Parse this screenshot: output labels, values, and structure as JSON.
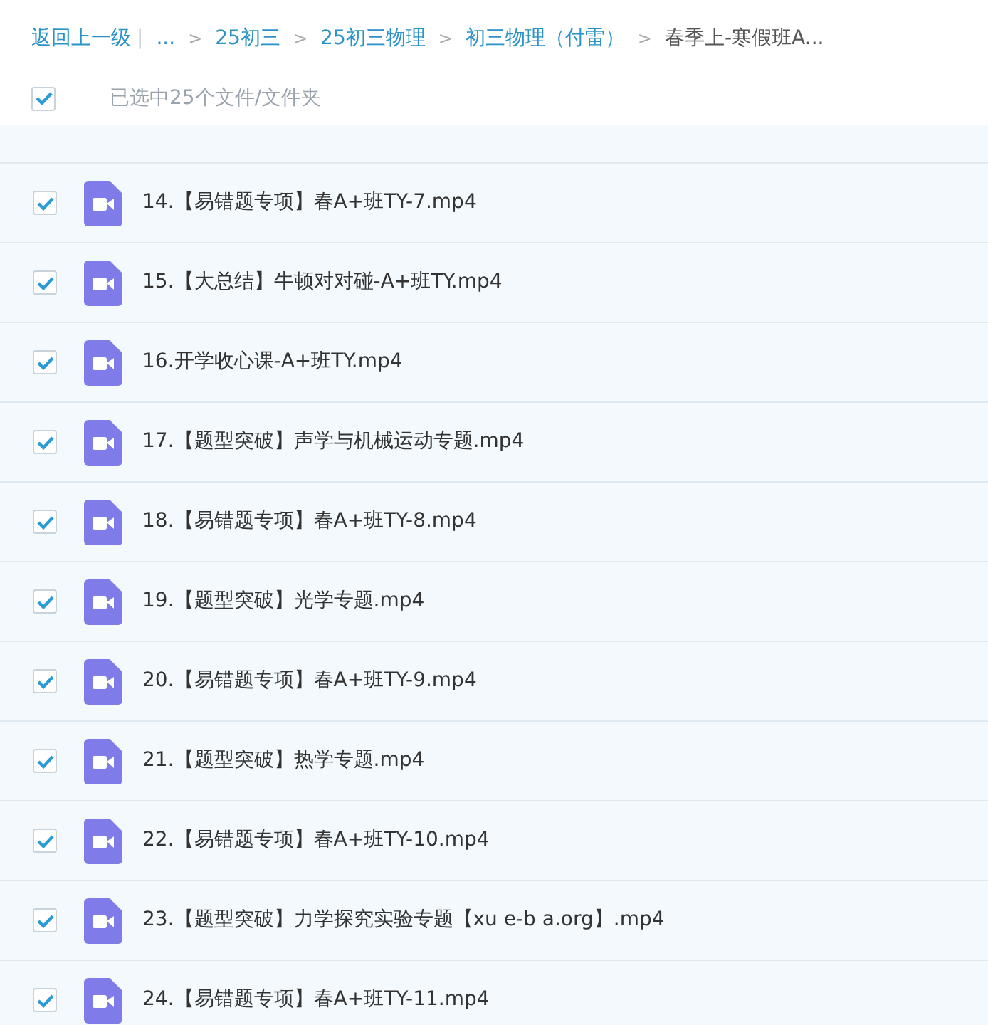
{
  "breadcrumb": {
    "back": "返回上一级",
    "divider": "|",
    "items": [
      {
        "label": "...",
        "current": false
      },
      {
        "label": "25初三",
        "current": false
      },
      {
        "label": "25初三物理",
        "current": false
      },
      {
        "label": "初三物理（付雷）",
        "current": false
      },
      {
        "label": "春季上-寒假班A...",
        "current": true
      }
    ],
    "separator": ">"
  },
  "selection": {
    "checked": true,
    "label": "已选中25个文件/文件夹"
  },
  "files": [
    {
      "name": "14.【易错题专项】春A+班TY-7.mp4",
      "checked": true
    },
    {
      "name": "15.【大总结】牛顿对对碰-A+班TY.mp4",
      "checked": true
    },
    {
      "name": "16.开学收心课-A+班TY.mp4",
      "checked": true
    },
    {
      "name": "17.【题型突破】声学与机械运动专题.mp4",
      "checked": true
    },
    {
      "name": "18.【易错题专项】春A+班TY-8.mp4",
      "checked": true
    },
    {
      "name": "19.【题型突破】光学专题.mp4",
      "checked": true
    },
    {
      "name": "20.【易错题专项】春A+班TY-9.mp4",
      "checked": true
    },
    {
      "name": "21.【题型突破】热学专题.mp4",
      "checked": true
    },
    {
      "name": "22.【易错题专项】春A+班TY-10.mp4",
      "checked": true
    },
    {
      "name": "23.【题型突破】力学探究实验专题【xu e-b a.org】.mp4",
      "checked": true
    },
    {
      "name": "24.【易错题专项】春A+班TY-11.mp4",
      "checked": true
    }
  ]
}
